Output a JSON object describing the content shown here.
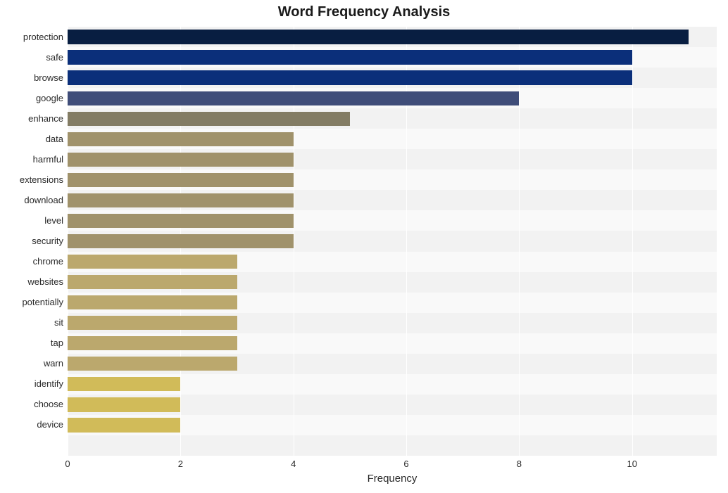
{
  "chart_data": {
    "type": "bar",
    "orientation": "horizontal",
    "title": "Word Frequency Analysis",
    "xlabel": "Frequency",
    "ylabel": "",
    "xlim": [
      0,
      11.5
    ],
    "xticks": [
      0,
      2,
      4,
      6,
      8,
      10
    ],
    "categories": [
      "protection",
      "safe",
      "browse",
      "google",
      "enhance",
      "data",
      "harmful",
      "extensions",
      "download",
      "level",
      "security",
      "chrome",
      "websites",
      "potentially",
      "sit",
      "tap",
      "warn",
      "identify",
      "choose",
      "device"
    ],
    "values": [
      11,
      10,
      10,
      8,
      5,
      4,
      4,
      4,
      4,
      4,
      4,
      3,
      3,
      3,
      3,
      3,
      3,
      2,
      2,
      2
    ],
    "colors": [
      "#081e41",
      "#0b2f7a",
      "#0b2f7a",
      "#3f4d79",
      "#837c64",
      "#a0926b",
      "#a0926b",
      "#a0926b",
      "#a0926b",
      "#a0926b",
      "#a0926b",
      "#bba86d",
      "#bba86d",
      "#bba86d",
      "#bba86d",
      "#bba86d",
      "#bba86d",
      "#d1bb59",
      "#d1bb59",
      "#d1bb59"
    ]
  }
}
